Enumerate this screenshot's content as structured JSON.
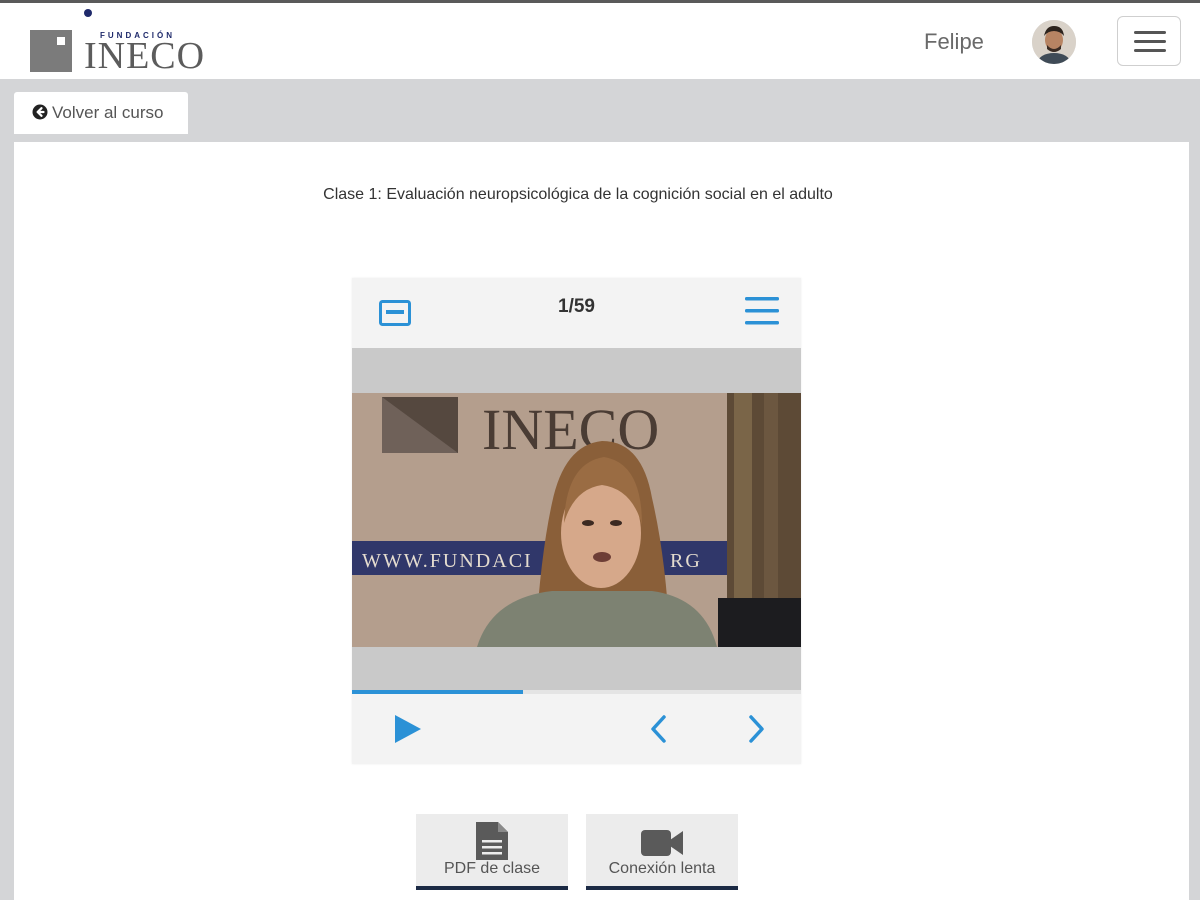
{
  "header": {
    "logo_small": "FUNDACIÓN",
    "logo_main": "INECO",
    "user_name": "Felipe",
    "avatar_icon": "user-avatar",
    "menu_icon": "hamburger-menu-icon"
  },
  "nav": {
    "back_label": "Volver al curso",
    "back_icon": "arrow-circle-left-icon"
  },
  "lesson": {
    "title": "Clase 1: Evaluación neuropsicológica de la cognición  social en el adulto"
  },
  "player": {
    "counter": "1/59",
    "progress_fraction": 0.38,
    "accent_color": "#2b91d6",
    "video": {
      "backdrop_logo": "INECO",
      "backdrop_url": "WWW.FUNDACI",
      "backdrop_url_tail": "RG"
    }
  },
  "actions": [
    {
      "label": "PDF de clase",
      "icon": "document-icon"
    },
    {
      "label": "Conexión lenta",
      "icon": "video-camera-icon"
    }
  ]
}
